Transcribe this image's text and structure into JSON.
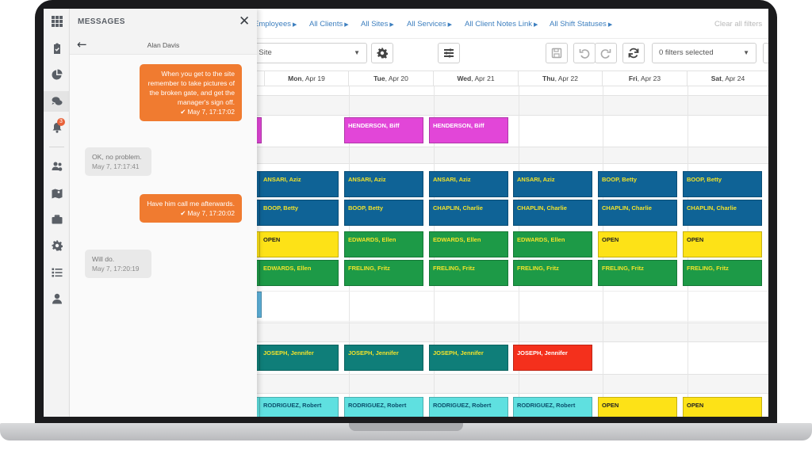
{
  "messages_panel": {
    "title": "MESSAGES",
    "close_glyph": "✕",
    "back_glyph": "←",
    "contact_name": "Alan Davis",
    "messages": [
      {
        "direction": "out",
        "text": "When you get to the site remember to take pictures of the broken gate, and get the manager's sign off.",
        "time": "May 7, 17:17:02"
      },
      {
        "direction": "in",
        "text": "OK, no problem.",
        "time": "May 7, 17:17:41"
      },
      {
        "direction": "out",
        "text": "Have him call me afterwards.",
        "time": "May 7, 17:20:02"
      },
      {
        "direction": "in",
        "text": "Will do.",
        "time": "May 7, 17:20:19"
      }
    ]
  },
  "icon_bar": {
    "icons": [
      "grid-icon",
      "clipboard-check-icon",
      "pie-chart-icon",
      "chat-icon",
      "bell-icon",
      "users-cog-icon",
      "map-icon",
      "briefcase-icon",
      "gear-icon",
      "list-icon",
      "user-icon"
    ],
    "notification_count": "3"
  },
  "filters": {
    "links": [
      "Employees",
      "All Clients",
      "All Sites",
      "All Services",
      "All Client Notes Link",
      "All Shift Statuses"
    ],
    "clear_all": "Clear all filters"
  },
  "toolbar": {
    "site_select_value": "y Site",
    "filters_select_value": "0 filters selected"
  },
  "schedule": {
    "days": [
      {
        "name": "Mon",
        "date": "Apr 19"
      },
      {
        "name": "Tue",
        "date": "Apr 20"
      },
      {
        "name": "Wed",
        "date": "Apr 21"
      },
      {
        "name": "Thu",
        "date": "Apr 22"
      },
      {
        "name": "Fri",
        "date": "Apr 23"
      },
      {
        "name": "Sat",
        "date": "Apr 24"
      }
    ],
    "colors": {
      "magenta": "#e246d8",
      "blue": "#0f6396",
      "yellow": "#fde217",
      "green": "#1d9a47",
      "teal": "#0f7e79",
      "red": "#f4301c",
      "cyan": "#5fe0e0",
      "skyblue": "#5fb4dd"
    },
    "shifts": [
      {
        "row": 0,
        "day": 1,
        "label": "HENDERSON, Biff",
        "color": "magenta"
      },
      {
        "row": 0,
        "day": 2,
        "label": "HENDERSON, Biff",
        "color": "magenta"
      },
      {
        "row": 1,
        "day": 0,
        "label": "ANSARI, Aziz",
        "color": "blue"
      },
      {
        "row": 1,
        "day": 1,
        "label": "ANSARI, Aziz",
        "color": "blue"
      },
      {
        "row": 1,
        "day": 2,
        "label": "ANSARI, Aziz",
        "color": "blue"
      },
      {
        "row": 1,
        "day": 3,
        "label": "ANSARI, Aziz",
        "color": "blue"
      },
      {
        "row": 1,
        "day": 4,
        "label": "BOOP, Betty",
        "color": "blue"
      },
      {
        "row": 1,
        "day": 5,
        "label": "BOOP, Betty",
        "color": "blue"
      },
      {
        "row": 2,
        "day": 0,
        "label": "BOOP, Betty",
        "color": "blue"
      },
      {
        "row": 2,
        "day": 1,
        "label": "BOOP, Betty",
        "color": "blue"
      },
      {
        "row": 2,
        "day": 2,
        "label": "CHAPLIN, Charlie",
        "color": "blue"
      },
      {
        "row": 2,
        "day": 3,
        "label": "CHAPLIN, Charlie",
        "color": "blue"
      },
      {
        "row": 2,
        "day": 4,
        "label": "CHAPLIN, Charlie",
        "color": "blue"
      },
      {
        "row": 2,
        "day": 5,
        "label": "CHAPLIN, Charlie",
        "color": "blue"
      },
      {
        "row": 3,
        "day": 0,
        "label": "OPEN",
        "color": "yellow"
      },
      {
        "row": 3,
        "day": 1,
        "label": "EDWARDS, Ellen",
        "color": "green"
      },
      {
        "row": 3,
        "day": 2,
        "label": "EDWARDS, Ellen",
        "color": "green"
      },
      {
        "row": 3,
        "day": 3,
        "label": "EDWARDS, Ellen",
        "color": "green"
      },
      {
        "row": 3,
        "day": 4,
        "label": "OPEN",
        "color": "yellow"
      },
      {
        "row": 3,
        "day": 5,
        "label": "OPEN",
        "color": "yellow"
      },
      {
        "row": 4,
        "day": 0,
        "label": "EDWARDS, Ellen",
        "color": "green"
      },
      {
        "row": 4,
        "day": 1,
        "label": "FRELING, Fritz",
        "color": "green"
      },
      {
        "row": 4,
        "day": 2,
        "label": "FRELING, Fritz",
        "color": "green"
      },
      {
        "row": 4,
        "day": 3,
        "label": "FRELING, Fritz",
        "color": "green"
      },
      {
        "row": 4,
        "day": 4,
        "label": "FRELING, Fritz",
        "color": "green"
      },
      {
        "row": 4,
        "day": 5,
        "label": "FRELING, Fritz",
        "color": "green"
      },
      {
        "row": 5,
        "day": 0,
        "label": "JOSEPH, Jennifer",
        "color": "teal"
      },
      {
        "row": 5,
        "day": 1,
        "label": "JOSEPH, Jennifer",
        "color": "teal"
      },
      {
        "row": 5,
        "day": 2,
        "label": "JOSEPH, Jennifer",
        "color": "teal"
      },
      {
        "row": 5,
        "day": 3,
        "label": "JOSEPH, Jennifer",
        "color": "red"
      },
      {
        "row": 6,
        "day": 0,
        "label": "RODRIGUEZ, Robert",
        "color": "cyan"
      },
      {
        "row": 6,
        "day": 1,
        "label": "RODRIGUEZ, Robert",
        "color": "cyan"
      },
      {
        "row": 6,
        "day": 2,
        "label": "RODRIGUEZ, Robert",
        "color": "cyan"
      },
      {
        "row": 6,
        "day": 3,
        "label": "RODRIGUEZ, Robert",
        "color": "cyan"
      },
      {
        "row": 6,
        "day": 4,
        "label": "OPEN",
        "color": "yellow"
      },
      {
        "row": 6,
        "day": 5,
        "label": "OPEN",
        "color": "yellow"
      }
    ]
  }
}
